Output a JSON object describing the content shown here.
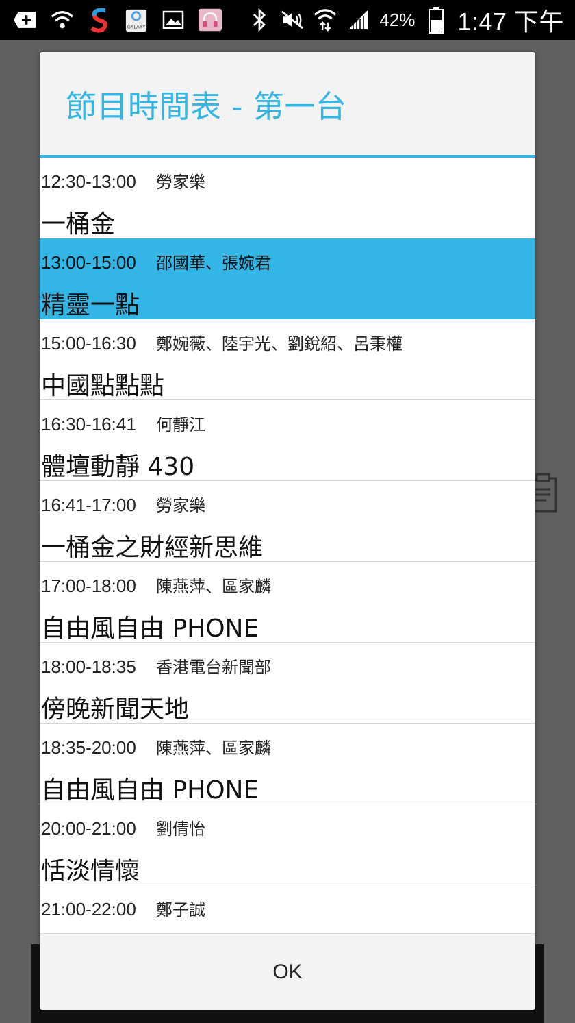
{
  "status_bar": {
    "battery": "42%",
    "time": "1:47 下午",
    "icons": [
      "add-icon",
      "wifi-icon",
      "s-app-icon",
      "galaxy-apps-icon",
      "image-icon",
      "headphones-icon",
      "bluetooth-icon",
      "mute-icon",
      "wifi-data-icon",
      "signal-icon",
      "battery-icon"
    ]
  },
  "dialog": {
    "title": "節目時間表 - 第一台",
    "ok_label": "OK",
    "accent_color": "#33b5e5",
    "programs": [
      {
        "time": "12:30-13:00",
        "hosts": "勞家樂",
        "title": "一桶金",
        "selected": false
      },
      {
        "time": "13:00-15:00",
        "hosts": "邵國華、張婉君",
        "title": "精靈一點",
        "selected": true
      },
      {
        "time": "15:00-16:30",
        "hosts": "鄭婉薇、陸宇光、劉銳紹、呂秉權",
        "title": "中國點點點",
        "selected": false
      },
      {
        "time": "16:30-16:41",
        "hosts": "何靜江",
        "title": "體壇動靜 430",
        "selected": false
      },
      {
        "time": "16:41-17:00",
        "hosts": "勞家樂",
        "title": "一桶金之財經新思維",
        "selected": false
      },
      {
        "time": "17:00-18:00",
        "hosts": "陳燕萍、區家麟",
        "title": "自由風自由 PHONE",
        "selected": false
      },
      {
        "time": "18:00-18:35",
        "hosts": "香港電台新聞部",
        "title": "傍晚新聞天地",
        "selected": false
      },
      {
        "time": "18:35-20:00",
        "hosts": "陳燕萍、區家麟",
        "title": "自由風自由 PHONE",
        "selected": false
      },
      {
        "time": "20:00-21:00",
        "hosts": "劉倩怡",
        "title": "恬淡情懷",
        "selected": false
      },
      {
        "time": "21:00-22:00",
        "hosts": "鄭子誠",
        "title": "",
        "selected": false
      }
    ]
  }
}
